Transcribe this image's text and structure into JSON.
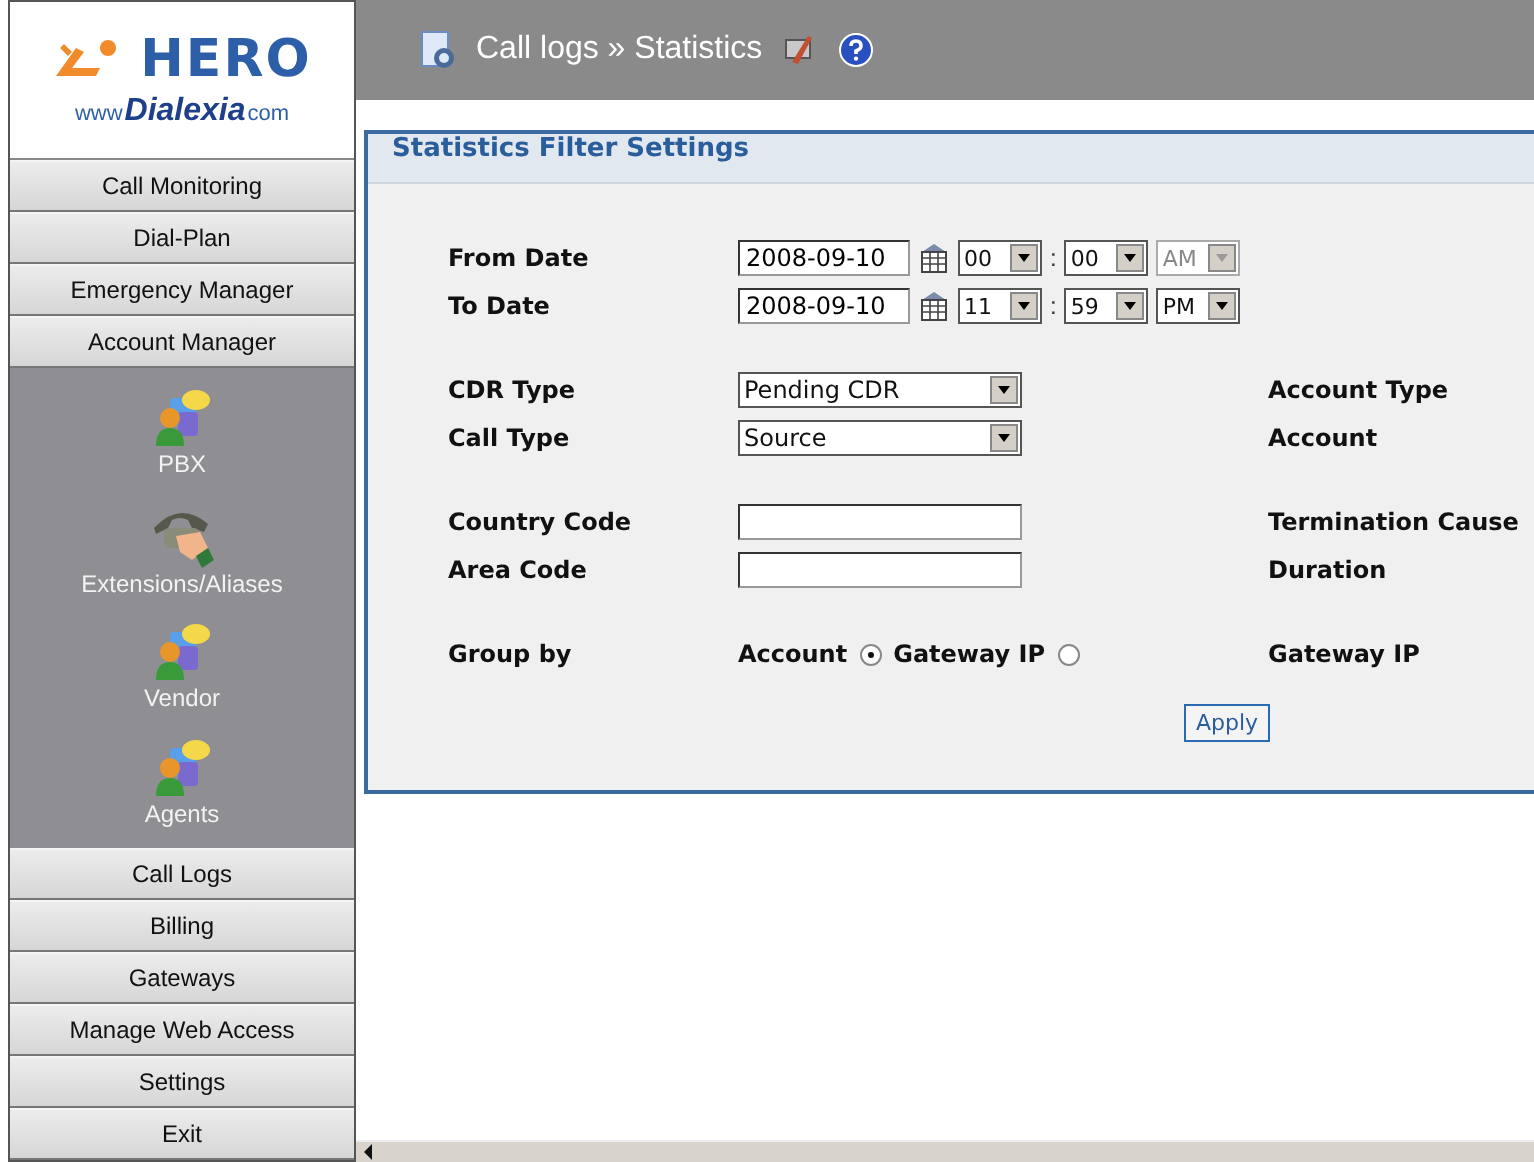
{
  "logo": {
    "brand": "HERO",
    "site_prefix": "www",
    "site_name": "Dialexia",
    "site_suffix": "com"
  },
  "sidebar": {
    "items": [
      {
        "label": "Call Monitoring"
      },
      {
        "label": "Dial-Plan"
      },
      {
        "label": "Emergency Manager"
      },
      {
        "label": "Account Manager",
        "children": [
          {
            "label": "PBX",
            "kind": "people"
          },
          {
            "label": "Extensions/Aliases",
            "kind": "phone"
          },
          {
            "label": "Vendor",
            "kind": "people"
          },
          {
            "label": "Agents",
            "kind": "people"
          }
        ]
      },
      {
        "label": "Call Logs"
      },
      {
        "label": "Billing"
      },
      {
        "label": "Gateways"
      },
      {
        "label": "Manage Web Access"
      },
      {
        "label": "Settings"
      },
      {
        "label": "Exit"
      }
    ]
  },
  "header": {
    "breadcrumb": "Call logs » Statistics"
  },
  "panel": {
    "title": "Statistics Filter Settings",
    "date_rows": [
      {
        "label": "From Date",
        "date": "2008-09-10",
        "hour": "00",
        "separator": ":",
        "minute": "00",
        "period": {
          "value": "AM",
          "disabled": true
        }
      },
      {
        "label": "To Date",
        "date": "2008-09-10",
        "hour": "11",
        "separator": ":",
        "minute": "59",
        "period": {
          "value": "PM",
          "disabled": false
        }
      }
    ],
    "select_rows": [
      {
        "label": "CDR Type",
        "value": "Pending CDR",
        "right_label": "Account Type"
      },
      {
        "label": "Call Type",
        "value": "Source",
        "right_label": "Account"
      }
    ],
    "text_rows": [
      {
        "label": "Country Code",
        "right_label": "Termination Cause"
      },
      {
        "label": "Area Code",
        "right_label": "Duration"
      }
    ],
    "group_by": {
      "label": "Group by",
      "options": [
        {
          "label": "Account",
          "selected": true
        },
        {
          "label": "Gateway IP",
          "selected": false
        }
      ],
      "right_label": "Gateway IP"
    },
    "apply_button": "Apply"
  }
}
